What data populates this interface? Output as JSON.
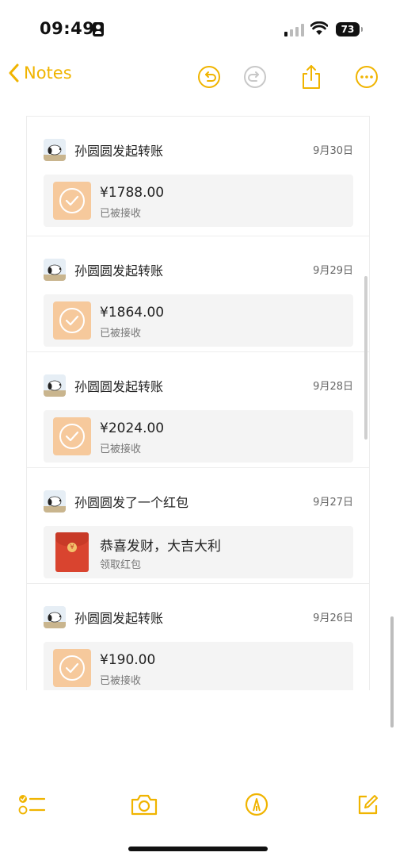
{
  "status_bar": {
    "time": "09:49",
    "battery": "73"
  },
  "nav": {
    "back_label": "Notes"
  },
  "entries": [
    {
      "sender": "孙圆圆发起转账",
      "date": "9月30日",
      "amount": "¥1788.00",
      "status": "已被接收",
      "type": "transfer"
    },
    {
      "sender": "孙圆圆发起转账",
      "date": "9月29日",
      "amount": "¥1864.00",
      "status": "已被接收",
      "type": "transfer"
    },
    {
      "sender": "孙圆圆发起转账",
      "date": "9月28日",
      "amount": "¥2024.00",
      "status": "已被接收",
      "type": "transfer"
    },
    {
      "sender": "孙圆圆发了一个红包",
      "date": "9月27日",
      "title": "恭喜发财，大吉大利",
      "status": "领取红包",
      "type": "red_packet"
    },
    {
      "sender": "孙圆圆发起转账",
      "date": "9月26日",
      "amount": "¥190.00",
      "status": "已被接收",
      "type": "transfer"
    }
  ],
  "colors": {
    "accent": "#f0b400",
    "transfer_icon": "#f6c99c",
    "red_packet": "#d9442f"
  },
  "icons": {
    "toolbar": [
      "checklist-icon",
      "camera-icon",
      "markup-pen-icon",
      "compose-icon"
    ],
    "nav": [
      "chevron-left-icon",
      "undo-icon",
      "redo-icon",
      "share-icon",
      "more-icon"
    ]
  }
}
